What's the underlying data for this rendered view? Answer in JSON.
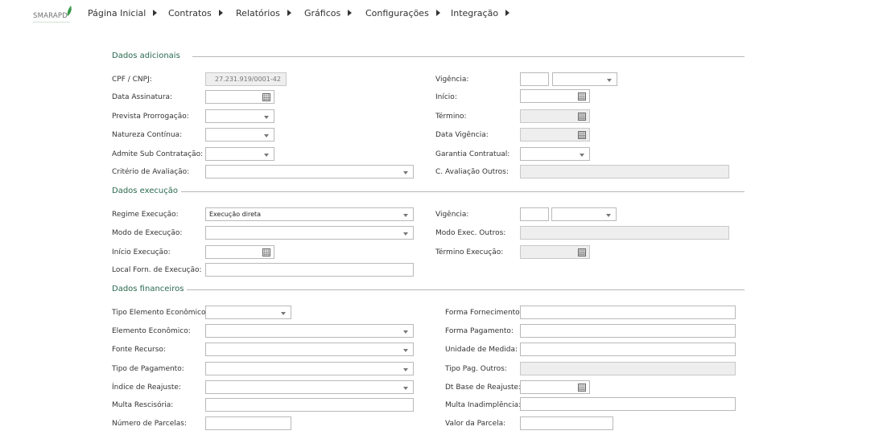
{
  "logo": {
    "text": "SMARAPD"
  },
  "menu": [
    "Página Inicial",
    "Contratos",
    "Relatórios",
    "Gráficos",
    "Configurações",
    "Integração"
  ],
  "icons": {
    "dropdown": "caret-down-icon",
    "calendar": "calendar-icon",
    "menu_arrow": "caret-right-icon"
  },
  "colors": {
    "section_title": "#2a6a4f",
    "logo_leaf": "#3a9a4a"
  },
  "adicionais": {
    "title": "Dados adicionais",
    "cpf_cnpj_label": "CPF / CNPJ:",
    "cpf_cnpj_value": "27.231.919/0001-42",
    "data_assinatura_label": "Data Assinatura:",
    "prevista_prorrogacao_label": "Prevista Prorrogação:",
    "natureza_continua_label": "Natureza Contínua:",
    "admite_sub_label": "Admite Sub Contratação:",
    "criterio_avaliacao_label": "Critério de Avaliação:",
    "vigencia_label": "Vigência:",
    "inicio_label": "Início:",
    "termino_label": "Término:",
    "data_vigencia_label": "Data Vigência:",
    "garantia_label": "Garantia Contratual:",
    "c_avaliacao_outros_label": "C. Avaliação Outros:"
  },
  "execucao": {
    "title": "Dados execução",
    "regime_label": "Regime Execução:",
    "regime_value": "Execução direta",
    "modo_label": "Modo de Execução:",
    "inicio_label": "Início Execução:",
    "local_label": "Local Forn. de Execução:",
    "vigencia_label": "Vigência:",
    "modo_outros_label": "Modo Exec. Outros:",
    "termino_label": "Término Execução:"
  },
  "financeiros": {
    "title": "Dados financeiros",
    "tipo_elemento_label": "Tipo Elemento Econômico:",
    "elemento_label": "Elemento Econômico:",
    "fonte_label": "Fonte Recurso:",
    "tipo_pagamento_label": "Tipo de Pagamento:",
    "indice_reajuste_label": "Índice de Reajuste:",
    "multa_rescisoria_label": "Multa Rescisória:",
    "numero_parcelas_label": "Número de Parcelas:",
    "forma_fornecimento_label": "Forma Fornecimento:",
    "forma_pagamento_label": "Forma Pagamento:",
    "unidade_medida_label": "Unidade de Medida:",
    "tipo_pag_outros_label": "Tipo Pag. Outros:",
    "dt_base_reajuste_label": "Dt Base de Reajuste:",
    "multa_inadimplencia_label": "Multa Inadimplência:",
    "valor_parcela_label": "Valor da Parcela:"
  }
}
